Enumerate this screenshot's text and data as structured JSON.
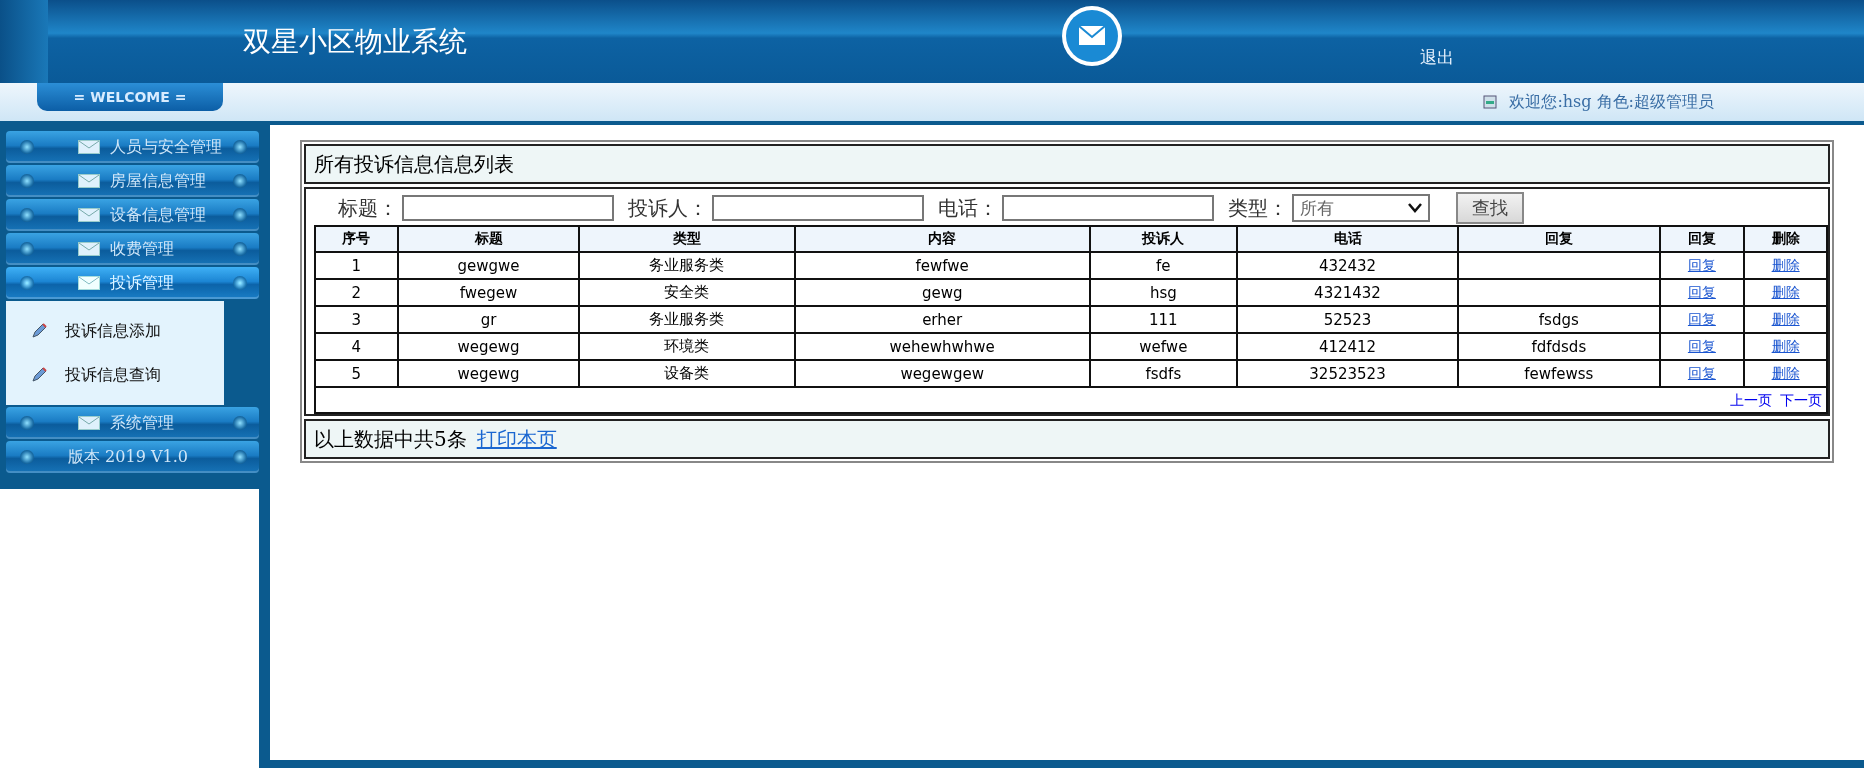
{
  "header": {
    "title": "双星小区物业系统",
    "logout": "退出"
  },
  "welcome_bar": {
    "badge": "= WELCOME =",
    "user_info": "欢迎您:hsg 角色:超级管理员"
  },
  "sidebar": {
    "items": [
      {
        "kind": "section",
        "label": "人员与安全管理",
        "expanded": false
      },
      {
        "kind": "section",
        "label": "房屋信息管理",
        "expanded": false
      },
      {
        "kind": "section",
        "label": "设备信息管理",
        "expanded": false
      },
      {
        "kind": "section",
        "label": "收费管理",
        "expanded": false
      },
      {
        "kind": "section",
        "label": "投诉管理",
        "expanded": true,
        "children": [
          {
            "label": "投诉信息添加"
          },
          {
            "label": "投诉信息查询"
          }
        ]
      },
      {
        "kind": "section",
        "label": "系统管理",
        "expanded": false
      },
      {
        "kind": "version",
        "label": "版本 2019 V1.0",
        "expanded": false
      }
    ]
  },
  "panel": {
    "title": "所有投诉信息信息列表",
    "search": {
      "fields": [
        {
          "label": "标题：",
          "kind": "text"
        },
        {
          "label": "投诉人：",
          "kind": "text"
        },
        {
          "label": "电话：",
          "kind": "text"
        },
        {
          "label": "类型：",
          "kind": "select",
          "value": "所有"
        }
      ],
      "button": "查找"
    },
    "table": {
      "columns": [
        "序号",
        "标题",
        "类型",
        "内容",
        "投诉人",
        "电话",
        "回复",
        "回复",
        "删除"
      ],
      "rows": [
        {
          "cells": [
            "1",
            "gewgwe",
            "务业服务类",
            "fewfwe",
            "fe",
            "432432",
            ""
          ],
          "actions": [
            "回复",
            "删除"
          ]
        },
        {
          "cells": [
            "2",
            "fwegew",
            "安全类",
            "gewg",
            "hsg",
            "4321432",
            ""
          ],
          "actions": [
            "回复",
            "删除"
          ]
        },
        {
          "cells": [
            "3",
            "gr",
            "务业服务类",
            "erher",
            "111",
            "52523",
            "fsdgs"
          ],
          "actions": [
            "回复",
            "删除"
          ]
        },
        {
          "cells": [
            "4",
            "wegewg",
            "环境类",
            "wehewhwhwe",
            "wefwe",
            "412412",
            "fdfdsds"
          ],
          "actions": [
            "回复",
            "删除"
          ]
        },
        {
          "cells": [
            "5",
            "wegewg",
            "设备类",
            "wegewgew",
            "fsdfs",
            "32523523",
            "fewfewss"
          ],
          "actions": [
            "回复",
            "删除"
          ]
        }
      ]
    },
    "pagination": [
      "上一页",
      "下一页"
    ],
    "footer": {
      "summary": "以上数据中共5条",
      "print_link": "打印本页"
    }
  }
}
